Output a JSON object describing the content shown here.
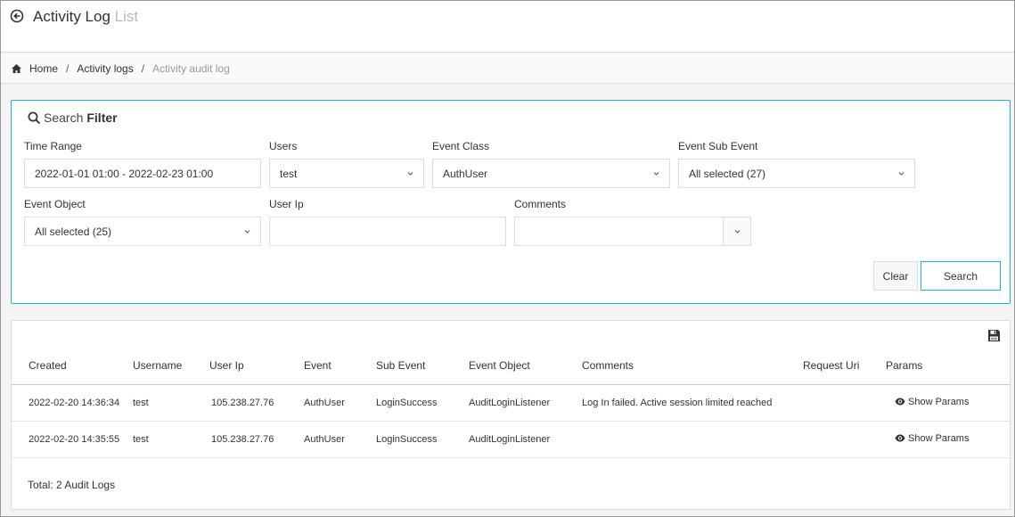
{
  "header": {
    "title": "Activity Log",
    "subtitle": "List",
    "back_icon": "arrow-circle-left-icon"
  },
  "breadcrumb": {
    "home_icon": "home-icon",
    "items": [
      "Home",
      "Activity logs",
      "Activity audit log"
    ],
    "separator": "/"
  },
  "filter": {
    "title_light": "Search",
    "title_bold": "Filter",
    "fields": {
      "time_range": {
        "label": "Time Range",
        "value": "2022-01-01 01:00 - 2022-02-23 01:00"
      },
      "users": {
        "label": "Users",
        "value": "test"
      },
      "event_class": {
        "label": "Event Class",
        "value": "AuthUser"
      },
      "event_sub_event": {
        "label": "Event Sub Event",
        "value": "All selected (27)"
      },
      "event_object": {
        "label": "Event Object",
        "value": "All selected (25)"
      },
      "user_ip": {
        "label": "User Ip",
        "value": ""
      },
      "comments": {
        "label": "Comments",
        "value": ""
      }
    },
    "clear_label": "Clear",
    "search_label": "Search"
  },
  "results": {
    "columns": [
      "Created",
      "Username",
      "User Ip",
      "Event",
      "Sub Event",
      "Event Object",
      "Comments",
      "Request Uri",
      "Params"
    ],
    "rows": [
      {
        "created": "2022-02-20 14:36:34",
        "username": "test",
        "user_ip": "105.238.27.76",
        "event": "AuthUser",
        "sub_event": "LoginSuccess",
        "event_object": "AuditLoginListener",
        "comments": "Log In failed. Active session limited reached",
        "request_uri": "",
        "params": "Show Params"
      },
      {
        "created": "2022-02-20 14:35:55",
        "username": "test",
        "user_ip": "105.238.27.76",
        "event": "AuthUser",
        "sub_event": "LoginSuccess",
        "event_object": "AuditLoginListener",
        "comments": "",
        "request_uri": "",
        "params": "Show Params"
      }
    ],
    "total": "Total: 2 Audit Logs"
  }
}
